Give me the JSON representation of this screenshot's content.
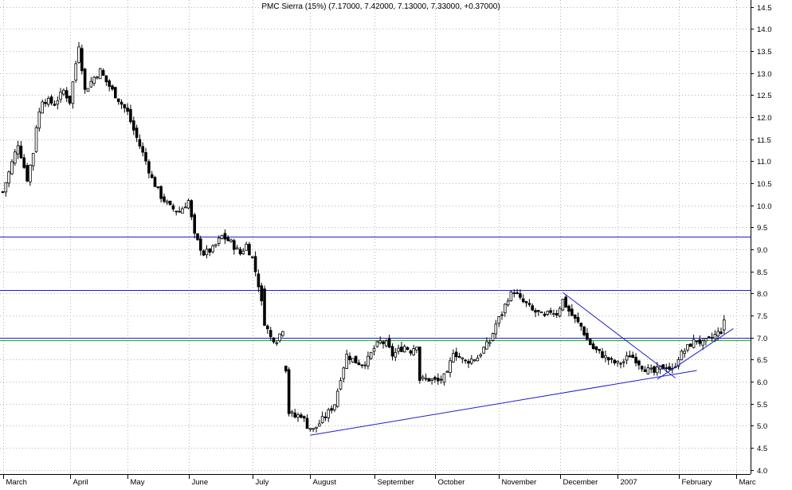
{
  "chart_data": {
    "type": "candlestick",
    "title": "PMC Sierra (15%) (7.17000, 7.42000, 7.13000, 7.33000, +0.37000)",
    "xlabel": "",
    "ylabel": "",
    "ylim": [
      4.0,
      14.5
    ],
    "y_ticks": [
      "4.0",
      "4.5",
      "5.0",
      "5.5",
      "6.0",
      "6.5",
      "7.0",
      "7.5",
      "8.0",
      "8.5",
      "9.0",
      "9.5",
      "10.0",
      "10.5",
      "11.0",
      "11.5",
      "12.0",
      "12.5",
      "13.0",
      "13.5",
      "14.0",
      "14.5"
    ],
    "x_ticks": [
      {
        "label": "March",
        "bar": 0
      },
      {
        "label": "April",
        "bar": 22
      },
      {
        "label": "May",
        "bar": 41
      },
      {
        "label": "June",
        "bar": 61
      },
      {
        "label": "July",
        "bar": 82
      },
      {
        "label": "August",
        "bar": 101
      },
      {
        "label": "September",
        "bar": 122
      },
      {
        "label": "October",
        "bar": 142
      },
      {
        "label": "November",
        "bar": 163
      },
      {
        "label": "December",
        "bar": 183
      },
      {
        "label": "2007",
        "bar": 202
      },
      {
        "label": "February",
        "bar": 222
      },
      {
        "label": "Marc",
        "bar": 241
      }
    ],
    "grid": true,
    "axis_position": "right",
    "horizontal_lines": [
      {
        "y": 9.28,
        "color": "#1f1fcc"
      },
      {
        "y": 8.07,
        "color": "#1f1fcc"
      },
      {
        "y": 7.0,
        "color": "#1f1fcc"
      },
      {
        "y": 6.94,
        "color": "#19b219"
      }
    ],
    "trend_lines": [
      {
        "bar1": 101,
        "y1": 4.78,
        "bar2": 228,
        "y2": 6.25,
        "color": "#1f1fcc"
      },
      {
        "bar1": 184,
        "y1": 8.02,
        "bar2": 221,
        "y2": 6.08,
        "color": "#1f1fcc"
      },
      {
        "bar1": 215,
        "y1": 6.05,
        "bar2": 240,
        "y2": 7.2,
        "color": "#1f1fcc"
      }
    ],
    "ohlc_anchors": [
      [
        0,
        10.3
      ],
      [
        5,
        11.4
      ],
      [
        8,
        10.6
      ],
      [
        10,
        11.2
      ],
      [
        11,
        11.8
      ],
      [
        13,
        12.4
      ],
      [
        17,
        12.3
      ],
      [
        20,
        12.6
      ],
      [
        22,
        12.35
      ],
      [
        25,
        13.65
      ],
      [
        27,
        12.6
      ],
      [
        30,
        12.9
      ],
      [
        32,
        13.05
      ],
      [
        34,
        12.8
      ],
      [
        37,
        12.5
      ],
      [
        41,
        12.1
      ],
      [
        43,
        11.7
      ],
      [
        47,
        11.0
      ],
      [
        49,
        10.6
      ],
      [
        52,
        10.2
      ],
      [
        55,
        9.95
      ],
      [
        58,
        9.85
      ],
      [
        61,
        10.1
      ],
      [
        63,
        9.3
      ],
      [
        66,
        8.9
      ],
      [
        69,
        9.0
      ],
      [
        72,
        9.3
      ],
      [
        75,
        9.15
      ],
      [
        78,
        8.9
      ],
      [
        80,
        9.1
      ],
      [
        82,
        8.8
      ],
      [
        84,
        8.2
      ],
      [
        86,
        7.35
      ],
      [
        88,
        7.0
      ],
      [
        90,
        6.95
      ],
      [
        92,
        7.2
      ],
      [
        93,
        6.3
      ],
      [
        94,
        5.3
      ],
      [
        96,
        5.2
      ],
      [
        98,
        5.25
      ],
      [
        100,
        5.0
      ],
      [
        102,
        4.9
      ],
      [
        104,
        5.05
      ],
      [
        107,
        5.3
      ],
      [
        109,
        5.5
      ],
      [
        111,
        6.1
      ],
      [
        113,
        6.6
      ],
      [
        116,
        6.45
      ],
      [
        118,
        6.4
      ],
      [
        120,
        6.5
      ],
      [
        122,
        6.75
      ],
      [
        124,
        6.9
      ],
      [
        126,
        6.85
      ],
      [
        128,
        6.6
      ],
      [
        130,
        6.7
      ],
      [
        132,
        6.8
      ],
      [
        134,
        6.7
      ],
      [
        136,
        6.85
      ],
      [
        137,
        6.05
      ],
      [
        140,
        6.05
      ],
      [
        143,
        6.0
      ],
      [
        146,
        6.15
      ],
      [
        148,
        6.7
      ],
      [
        150,
        6.55
      ],
      [
        152,
        6.45
      ],
      [
        154,
        6.5
      ],
      [
        156,
        6.55
      ],
      [
        158,
        6.75
      ],
      [
        160,
        6.9
      ],
      [
        162,
        7.3
      ],
      [
        164,
        7.55
      ],
      [
        166,
        7.9
      ],
      [
        168,
        8.05
      ],
      [
        170,
        7.85
      ],
      [
        172,
        7.75
      ],
      [
        174,
        7.6
      ],
      [
        176,
        7.55
      ],
      [
        178,
        7.45
      ],
      [
        180,
        7.6
      ],
      [
        182,
        7.55
      ],
      [
        184,
        7.85
      ],
      [
        186,
        7.6
      ],
      [
        188,
        7.4
      ],
      [
        190,
        7.25
      ],
      [
        192,
        6.95
      ],
      [
        194,
        6.75
      ],
      [
        196,
        6.65
      ],
      [
        198,
        6.55
      ],
      [
        200,
        6.45
      ],
      [
        202,
        6.4
      ],
      [
        204,
        6.45
      ],
      [
        206,
        6.6
      ],
      [
        208,
        6.5
      ],
      [
        210,
        6.35
      ],
      [
        212,
        6.25
      ],
      [
        214,
        6.2
      ],
      [
        216,
        6.3
      ],
      [
        218,
        6.35
      ],
      [
        220,
        6.25
      ],
      [
        222,
        6.55
      ],
      [
        224,
        6.7
      ],
      [
        226,
        6.85
      ],
      [
        228,
        6.95
      ],
      [
        230,
        6.85
      ],
      [
        232,
        6.95
      ],
      [
        234,
        7.05
      ],
      [
        236,
        7.15
      ],
      [
        237,
        7.33
      ]
    ]
  }
}
